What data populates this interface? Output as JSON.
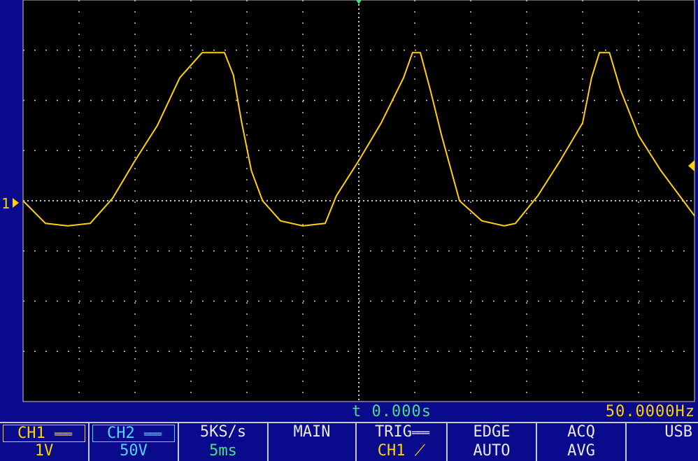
{
  "colors": {
    "background": "#0a0a8c",
    "screen": "#000000",
    "grid": "#c8c8c8",
    "trace_ch1": "#ffd200",
    "trigger_time": "#4ade80",
    "ch2": "#4fd4ff"
  },
  "screen": {
    "ch1_marker": "1",
    "trigger_time": "t 0.000s",
    "frequency": "50.0000Hz",
    "grid": true,
    "divisions_x": 12,
    "divisions_y": 8
  },
  "bottom_bar": {
    "ch1": {
      "label": "CH1",
      "coupling_icon": "dc-coupling-icon",
      "scale": "1V"
    },
    "ch2": {
      "label": "CH2",
      "coupling_icon": "dc-coupling-icon",
      "scale": "50V"
    },
    "timebase": {
      "sample_rate": "5KS/s",
      "time_div": "5ms"
    },
    "mode": {
      "label": "MAIN"
    },
    "trigger": {
      "label": "TRIG",
      "coupling_icon": "dc-coupling-icon",
      "source": "CH1",
      "slope_icon": "rising-edge-icon"
    },
    "trigger_type": {
      "type": "EDGE",
      "mode": "AUTO"
    },
    "acquisition": {
      "label": "ACQ",
      "mode": "AVG"
    },
    "storage": {
      "label": "USB"
    }
  },
  "chart_data": {
    "type": "line",
    "x_unit": "ms",
    "y_unit": "V",
    "time_per_div": 5,
    "volts_per_div": 1,
    "xlim": [
      -30,
      30
    ],
    "ylim": [
      -4,
      4
    ],
    "series": [
      {
        "x": [
          -30,
          -28,
          -26,
          -24,
          -22,
          -20,
          -18,
          -16,
          -14,
          -12,
          -11.2,
          -10.5,
          -9.6,
          -8.6,
          -7,
          -5,
          -3,
          -2,
          0,
          2,
          4,
          4.8,
          5.5,
          6.4,
          7.4,
          9,
          11,
          13,
          14,
          16,
          18,
          20,
          20.8,
          21.5,
          22.4,
          23.4,
          25,
          27,
          29,
          30
        ],
        "y": [
          0.0,
          -0.45,
          -0.5,
          -0.45,
          0.05,
          0.8,
          1.5,
          2.45,
          2.95,
          2.95,
          2.5,
          1.6,
          0.6,
          0.0,
          -0.4,
          -0.5,
          -0.45,
          0.1,
          0.8,
          1.55,
          2.45,
          2.95,
          2.95,
          2.2,
          1.3,
          0.0,
          -0.4,
          -0.5,
          -0.45,
          0.1,
          0.8,
          1.55,
          2.45,
          2.95,
          2.95,
          2.2,
          1.3,
          0.6,
          0.0,
          -0.3
        ]
      }
    ]
  }
}
